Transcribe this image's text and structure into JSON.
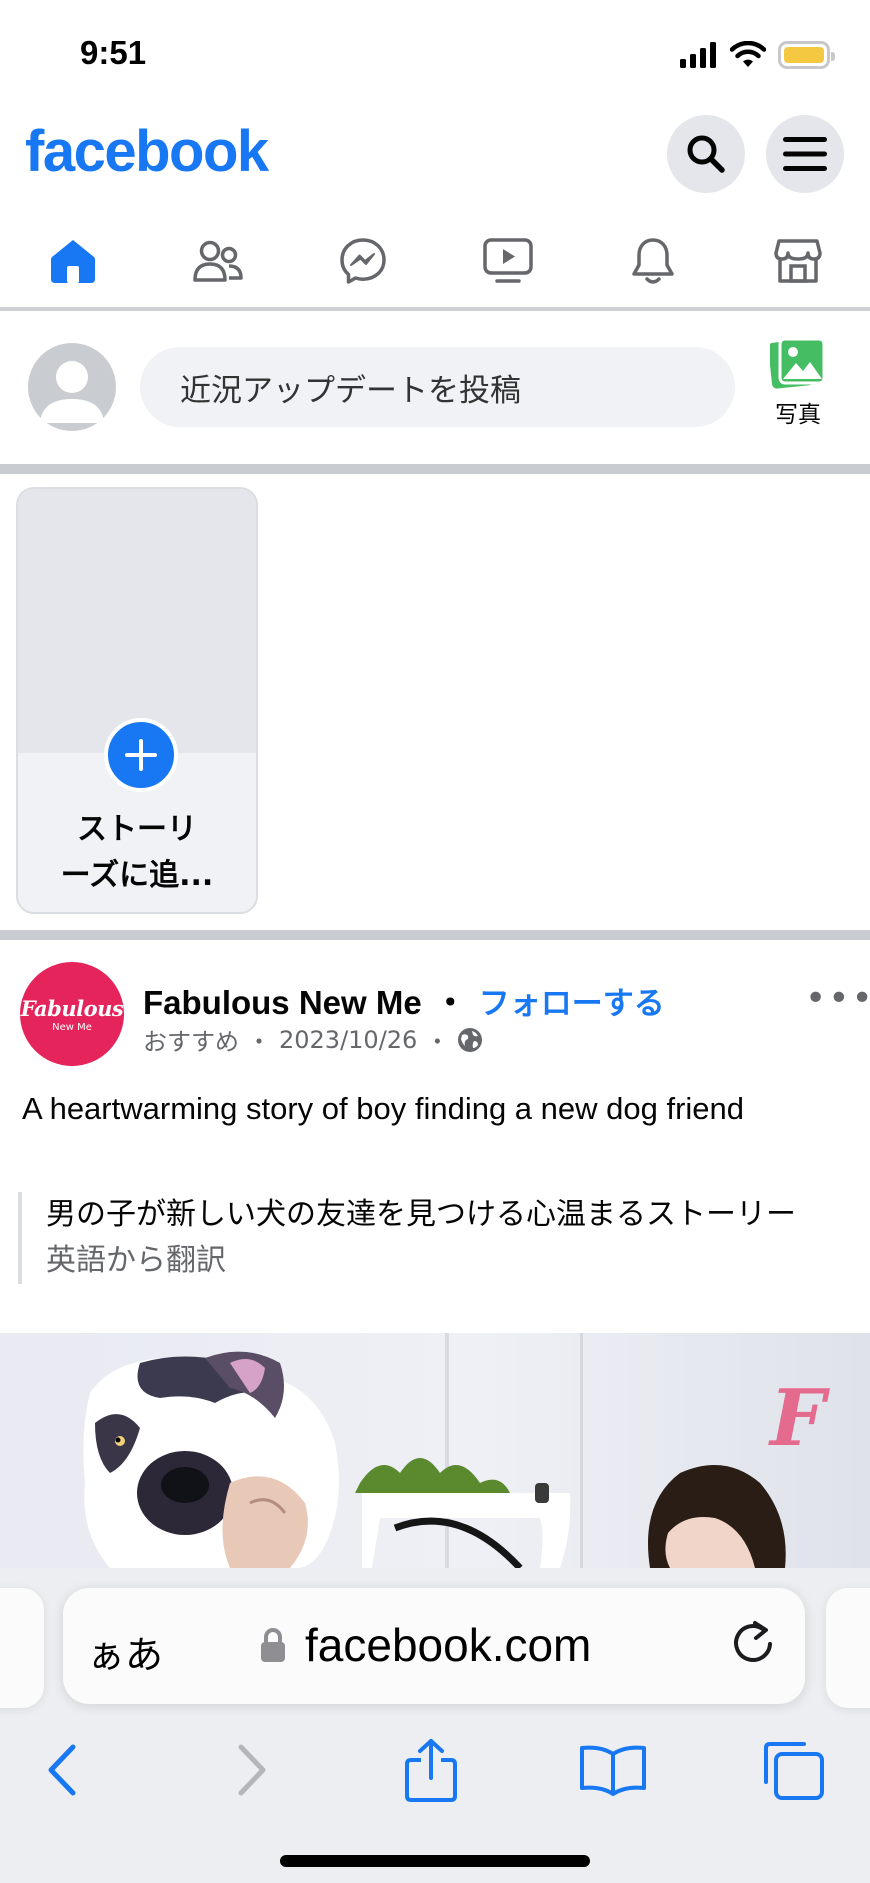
{
  "status_bar": {
    "time": "9:51",
    "icons": [
      "cellular-signal-icon",
      "wifi-icon",
      "battery-icon"
    ],
    "battery_color": "#f5c842"
  },
  "header": {
    "logo": "facebook",
    "buttons": [
      "search-icon",
      "menu-icon"
    ]
  },
  "nav": {
    "tabs": [
      "home",
      "friends",
      "messenger",
      "watch",
      "notifications",
      "marketplace"
    ],
    "active_tab": "home",
    "accent": "#1877f2"
  },
  "composer": {
    "placeholder": "近況アップデートを投稿",
    "photo_label": "写真"
  },
  "stories": {
    "create_label_line1": "ストーリ",
    "create_label_line2": "ーズに追..."
  },
  "post": {
    "page_name": "Fabulous New Me",
    "avatar_brand": "Fabulous",
    "avatar_brand_sub": "New Me",
    "separator": "・",
    "follow_label": "フォローする",
    "meta_label": "おすすめ",
    "meta_date": "2023/10/26",
    "text": "A heartwarming story of boy finding a new dog friend",
    "translation": "男の子が新しい犬の友達を見つける心温まるストーリー",
    "translation_note": "英語から翻訳",
    "image_logo_letter": "F"
  },
  "safari": {
    "text_size_label": "ぁあ",
    "url": "facebook.com",
    "toolbar": [
      "back-icon",
      "forward-icon",
      "share-icon",
      "bookmarks-icon",
      "tabs-icon"
    ]
  }
}
